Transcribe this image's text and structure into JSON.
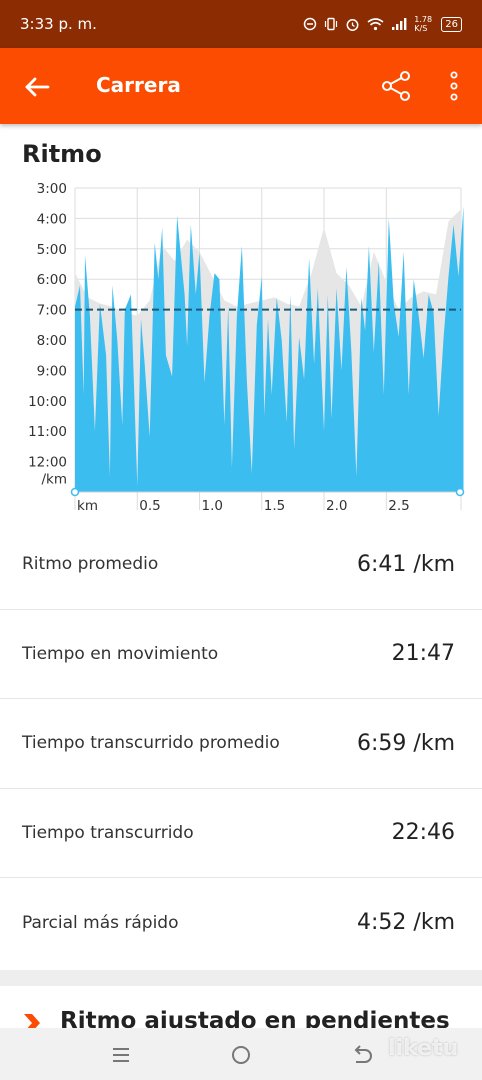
{
  "status_bar": {
    "time": "3:33 p. m.",
    "network_speed": "1.78 K/S",
    "battery": "26"
  },
  "app_bar": {
    "title": "Carrera"
  },
  "section": {
    "title": "Ritmo"
  },
  "chart_data": {
    "type": "area",
    "y_axis": {
      "labels": [
        "3:00",
        "4:00",
        "5:00",
        "6:00",
        "7:00",
        "8:00",
        "9:00",
        "10:00",
        "11:00",
        "12:00"
      ],
      "unit": "/km",
      "range": [
        "3:00",
        "13:00"
      ],
      "inverted": true
    },
    "x_axis": {
      "labels": [
        "km",
        "0.5",
        "1.0",
        "1.5",
        "2.0",
        "2.5"
      ],
      "range": [
        0,
        3.1
      ]
    },
    "average_pace_line": "7:00",
    "grid": true,
    "colors": {
      "pace_fill": "#3bbdf0",
      "smoothed_fill": "#e6e6e6",
      "average_line": "#1b5b78"
    },
    "series": [
      {
        "x": [
          0,
          0.04,
          0.07,
          0.08,
          0.12,
          0.16,
          0.2,
          0.25,
          0.28,
          0.3,
          0.34,
          0.38,
          0.4,
          0.45,
          0.5,
          0.53,
          0.56,
          0.6,
          0.64,
          0.67,
          0.7,
          0.73,
          0.78,
          0.82,
          0.85,
          0.88,
          0.9,
          0.93,
          0.97,
          1.0,
          1.04,
          1.08,
          1.12,
          1.16,
          1.2,
          1.23,
          1.26,
          1.3,
          1.34,
          1.38,
          1.42,
          1.46,
          1.5,
          1.52,
          1.55,
          1.58,
          1.62,
          1.66,
          1.7,
          1.73,
          1.76,
          1.8,
          1.84,
          1.88,
          1.92,
          1.95,
          2.0,
          2.03,
          2.06,
          2.1,
          2.14,
          2.18,
          2.22,
          2.26,
          2.3,
          2.33,
          2.36,
          2.4,
          2.44,
          2.48,
          2.52,
          2.56,
          2.6,
          2.64,
          2.68,
          2.72,
          2.76,
          2.8,
          2.84,
          2.88,
          2.92,
          2.96,
          3.0,
          3.04,
          3.08,
          3.12
        ],
        "values": [
          6.9,
          6.2,
          9.8,
          5.2,
          7.2,
          11.0,
          6.8,
          8.5,
          12.5,
          6.2,
          8.0,
          10.8,
          7.0,
          6.5,
          12.8,
          7.3,
          8.8,
          11.2,
          4.8,
          6.0,
          4.3,
          8.5,
          9.2,
          3.9,
          5.2,
          6.5,
          8.2,
          4.2,
          6.5,
          5.1,
          9.4,
          7.2,
          5.8,
          6.0,
          10.8,
          6.9,
          12.2,
          7.2,
          4.9,
          9.3,
          12.4,
          7.5,
          5.9,
          10.5,
          7.3,
          9.8,
          6.6,
          8.0,
          10.7,
          6.5,
          11.6,
          7.9,
          9.3,
          5.3,
          8.8,
          6.3,
          11.0,
          6.5,
          10.6,
          6.3,
          9.0,
          5.6,
          8.4,
          12.5,
          6.6,
          7.7,
          4.9,
          8.4,
          5.4,
          9.8,
          4.0,
          6.8,
          7.9,
          5.1,
          9.8,
          6.0,
          7.2,
          8.6,
          6.5,
          7.1,
          10.5,
          7.9,
          5.9,
          4.2,
          5.9,
          3.6
        ]
      },
      {
        "x": [
          0,
          0.1,
          0.2,
          0.3,
          0.4,
          0.5,
          0.6,
          0.7,
          0.8,
          0.9,
          1.0,
          1.1,
          1.2,
          1.3,
          1.4,
          1.5,
          1.6,
          1.7,
          1.8,
          1.9,
          2.0,
          2.1,
          2.2,
          2.3,
          2.4,
          2.5,
          2.6,
          2.7,
          2.8,
          2.9,
          3.0,
          3.1
        ],
        "values": [
          5.8,
          6.6,
          6.8,
          6.9,
          7.1,
          7.2,
          6.7,
          4.9,
          5.4,
          4.7,
          5.1,
          5.9,
          6.7,
          6.9,
          6.8,
          6.7,
          6.6,
          6.8,
          6.9,
          5.8,
          4.3,
          5.8,
          6.2,
          6.9,
          5.1,
          6.1,
          7.0,
          6.6,
          6.4,
          6.5,
          4.1,
          3.7
        ]
      }
    ]
  },
  "stats": [
    {
      "label": "Ritmo promedio",
      "value": "6:41 /km"
    },
    {
      "label": "Tiempo en movimiento",
      "value": "21:47"
    },
    {
      "label": "Tiempo transcurrido promedio",
      "value": "6:59 /km"
    },
    {
      "label": "Tiempo transcurrido",
      "value": "22:46"
    },
    {
      "label": "Parcial más rápido",
      "value": "4:52 /km"
    }
  ],
  "next_section": {
    "title": "Ritmo ajustado en pendientes"
  },
  "watermark": "liketu",
  "icons": [
    "back-arrow-icon",
    "share-icon",
    "more-vert-icon",
    "chevron-right-icon",
    "menu-icon",
    "home-icon",
    "back-icon"
  ],
  "colors": {
    "accent": "#fc4c02",
    "status_bar": "#8b2c03"
  }
}
